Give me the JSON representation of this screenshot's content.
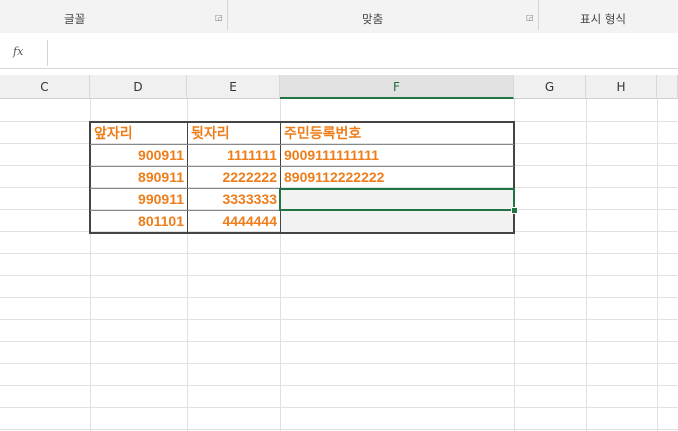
{
  "ribbon": {
    "groups": [
      "글꼴",
      "맞춤",
      "표시 형식"
    ]
  },
  "formula_bar": {
    "fx_label": "fx",
    "value": ""
  },
  "columns": [
    "C",
    "D",
    "E",
    "F",
    "G",
    "H"
  ],
  "selected_column": "F",
  "table": {
    "headers": [
      "앞자리",
      "뒷자리",
      "주민등록번호"
    ],
    "rows": [
      [
        "900911",
        "1111111",
        "9009111111111"
      ],
      [
        "890911",
        "2222222",
        "8909112222222"
      ],
      [
        "990911",
        "3333333",
        ""
      ],
      [
        "801101",
        "4444444",
        ""
      ]
    ]
  },
  "colors": {
    "text_accent": "#ee7d1a",
    "selection": "#217346"
  }
}
